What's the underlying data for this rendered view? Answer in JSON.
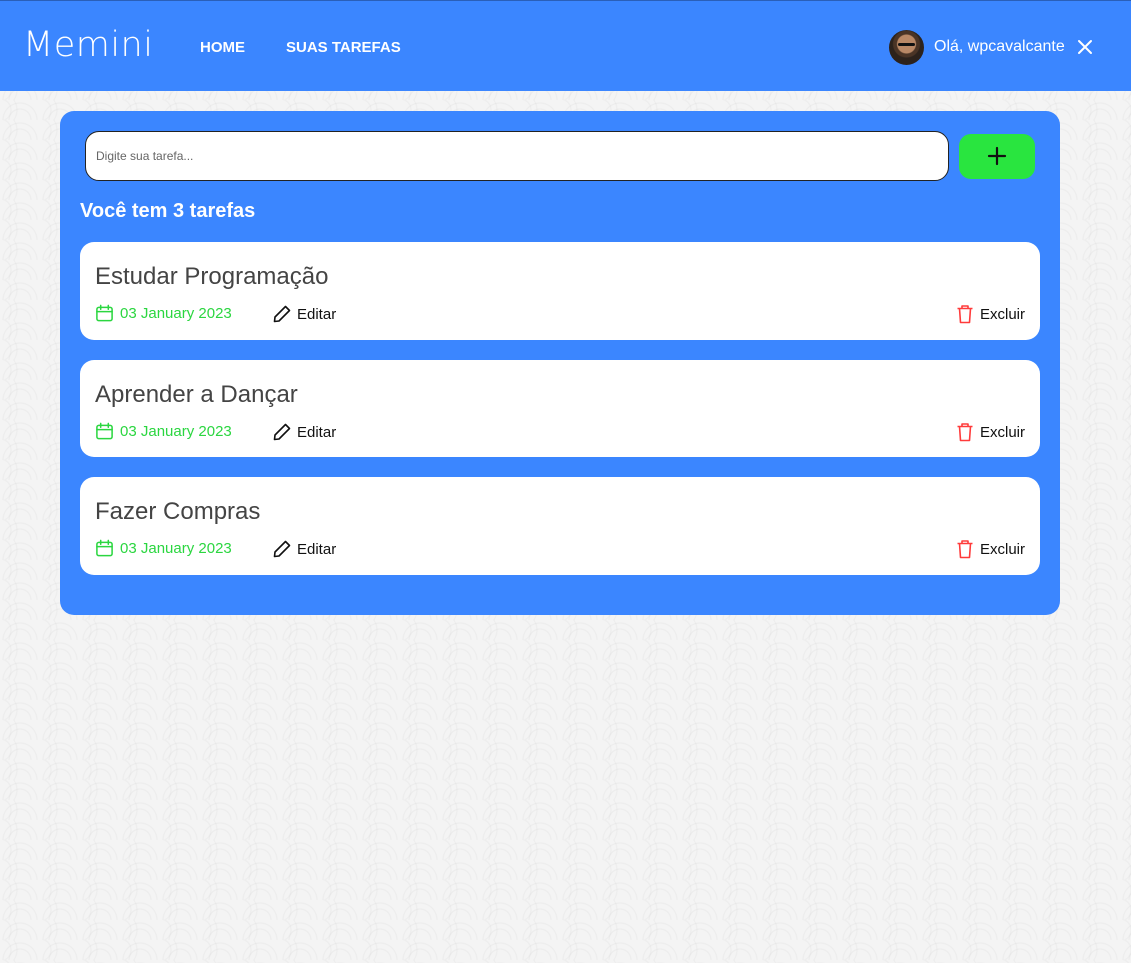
{
  "header": {
    "logo": "Memini",
    "nav": [
      {
        "label": "HOME"
      },
      {
        "label": "SUAS TAREFAS"
      }
    ],
    "greeting": "Olá, wpcavalcante",
    "close_icon": "close-icon"
  },
  "main": {
    "input_placeholder": "Digite sua tarefa...",
    "input_value": "",
    "add_button_icon": "plus-icon",
    "task_count_text": "Você tem 3 tarefas",
    "tasks": [
      {
        "title": "Estudar Programação",
        "date": "03 January 2023",
        "edit_label": "Editar",
        "delete_label": "Excluir"
      },
      {
        "title": "Aprender a Dançar",
        "date": "03 January 2023",
        "edit_label": "Editar",
        "delete_label": "Excluir"
      },
      {
        "title": "Fazer Compras",
        "date": "03 January 2023",
        "edit_label": "Editar",
        "delete_label": "Excluir"
      }
    ]
  },
  "colors": {
    "primary": "#3b86ff",
    "add_button": "#29e53f",
    "date_green": "#2bd640",
    "delete_red": "#ff3b3b"
  }
}
